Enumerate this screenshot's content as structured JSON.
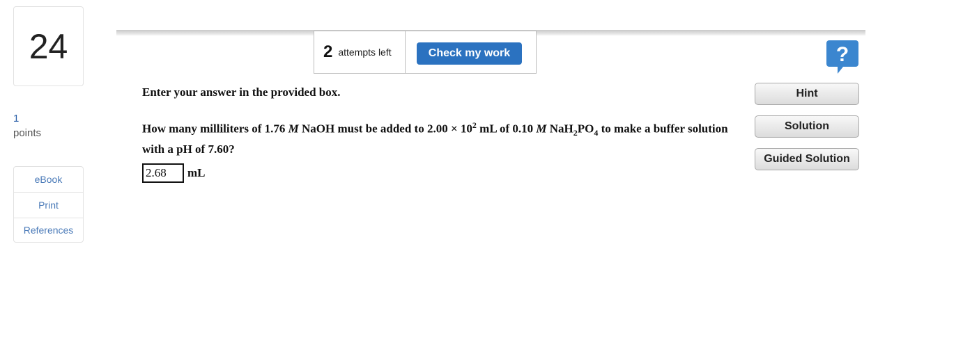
{
  "question_number": "24",
  "points": {
    "value": "1",
    "label": "points"
  },
  "side_links": [
    "eBook",
    "Print",
    "References"
  ],
  "toolbar": {
    "attempts_count": "2",
    "attempts_label": "attempts left",
    "check_label": "Check my work"
  },
  "help": {
    "icon": "help-question-icon",
    "color": "#3b86cf"
  },
  "question": {
    "instruction": "Enter your answer in the provided box.",
    "prompt_part1": "How many milliliters of 1.76 ",
    "molar_symbol": "M",
    "prompt_part2": " NaOH must be added to 2.00 × 10",
    "exponent": "2",
    "prompt_part3": " mL of 0.10 ",
    "prompt_part4": " NaH",
    "sub_2": "2",
    "po": "PO",
    "sub_4": "4",
    "prompt_part5": " to make a buffer solution with a pH of 7.60?",
    "answer_value": "2.68",
    "unit": "mL"
  },
  "buttons": {
    "hint": "Hint",
    "solution": "Solution",
    "guided": "Guided Solution"
  },
  "colors": {
    "accent": "#2b72c0",
    "link": "#4a7ab8"
  }
}
